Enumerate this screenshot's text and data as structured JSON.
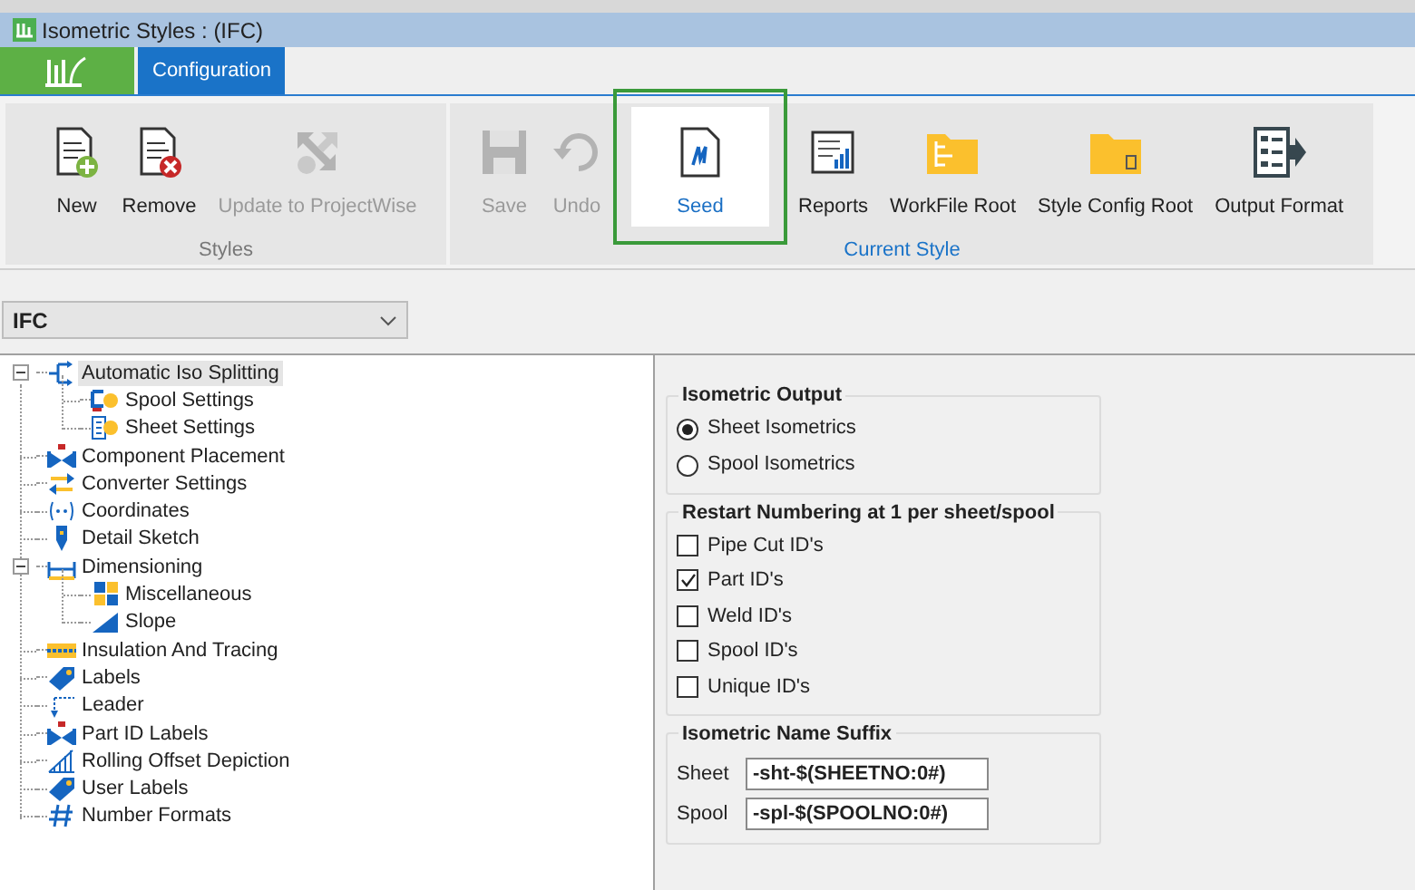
{
  "window": {
    "title": "Isometric Styles : (IFC)"
  },
  "tabs": [
    {
      "label": "Configuration",
      "selected": true
    }
  ],
  "ribbon": {
    "groups": [
      {
        "label": "Styles",
        "buttons": [
          {
            "label": "New",
            "disabled": false,
            "highlighted": false
          },
          {
            "label": "Remove",
            "disabled": false,
            "highlighted": false
          },
          {
            "label": "Update to ProjectWise",
            "disabled": true,
            "highlighted": false
          }
        ]
      },
      {
        "label": "Current Style",
        "buttons": [
          {
            "label": "Save",
            "disabled": true,
            "highlighted": false
          },
          {
            "label": "Undo",
            "disabled": true,
            "highlighted": false
          },
          {
            "label": "Seed",
            "disabled": false,
            "highlighted": true
          },
          {
            "label": "Reports",
            "disabled": false,
            "highlighted": false
          },
          {
            "label": "WorkFile Root",
            "disabled": false,
            "highlighted": false
          },
          {
            "label": "Style Config Root",
            "disabled": false,
            "highlighted": false
          },
          {
            "label": "Output Format",
            "disabled": false,
            "highlighted": false
          }
        ]
      }
    ]
  },
  "style_dropdown": {
    "value": "IFC"
  },
  "tree": [
    {
      "label": "Automatic Iso Splitting",
      "selected": true,
      "expanded": true,
      "children": [
        {
          "label": "Spool Settings",
          "selected": false
        },
        {
          "label": "Sheet Settings",
          "selected": false
        }
      ]
    },
    {
      "label": "Component Placement",
      "selected": false
    },
    {
      "label": "Converter Settings",
      "selected": false
    },
    {
      "label": "Coordinates",
      "selected": false
    },
    {
      "label": "Detail Sketch",
      "selected": false
    },
    {
      "label": "Dimensioning",
      "selected": false,
      "expanded": true,
      "children": [
        {
          "label": "Miscellaneous",
          "selected": false
        },
        {
          "label": "Slope",
          "selected": false
        }
      ]
    },
    {
      "label": "Insulation And Tracing",
      "selected": false
    },
    {
      "label": "Labels",
      "selected": false
    },
    {
      "label": "Leader",
      "selected": false
    },
    {
      "label": "Part ID Labels",
      "selected": false
    },
    {
      "label": "Rolling Offset Depiction",
      "selected": false
    },
    {
      "label": "User Labels",
      "selected": false
    },
    {
      "label": "Number Formats",
      "selected": false
    }
  ],
  "isometric_output": {
    "title": "Isometric Output",
    "options": [
      {
        "label": "Sheet Isometrics",
        "selected": true
      },
      {
        "label": "Spool Isometrics",
        "selected": false
      }
    ]
  },
  "restart_numbering": {
    "title": "Restart Numbering at 1 per sheet/spool",
    "items": [
      {
        "label": "Pipe Cut ID's",
        "checked": false
      },
      {
        "label": "Part ID's",
        "checked": true
      },
      {
        "label": "Weld ID's",
        "checked": false
      },
      {
        "label": "Spool ID's",
        "checked": false
      },
      {
        "label": "Unique ID's",
        "checked": false
      }
    ]
  },
  "name_suffix": {
    "title": "Isometric Name Suffix",
    "fields": [
      {
        "label": "Sheet",
        "value": "-sht-$(SHEETNO:0#)"
      },
      {
        "label": "Spool",
        "value": "-spl-$(SPOOLNO:0#)"
      }
    ]
  }
}
